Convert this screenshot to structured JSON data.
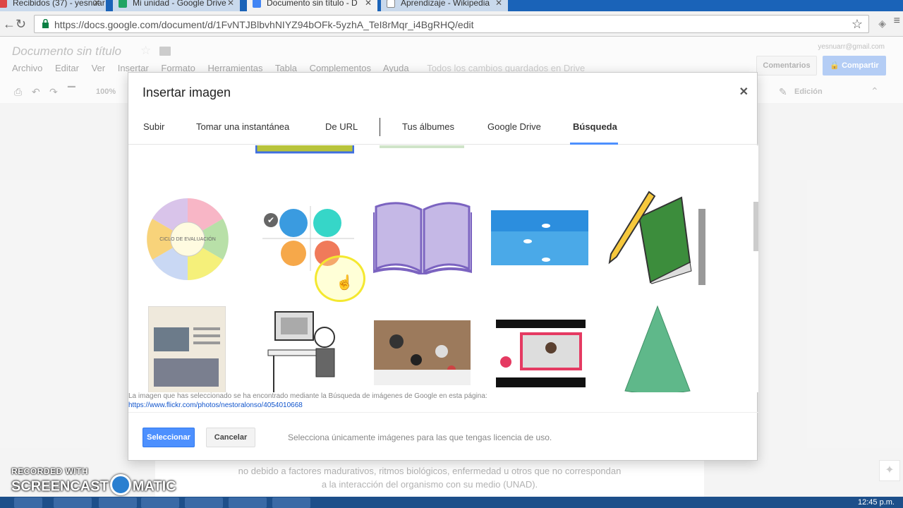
{
  "browser": {
    "tabs": [
      {
        "title": "Recibidos (37) - yesnuar",
        "active": false
      },
      {
        "title": "Mi unidad - Google Drive",
        "active": false
      },
      {
        "title": "Documento sin título - D",
        "active": true
      },
      {
        "title": "Aprendizaje - Wikipedia",
        "active": false
      }
    ],
    "url": "https://docs.google.com/document/d/1FvNTJBlbvhNIYZ94bOFk-5yzhA_TeI8rMqr_i4BgRHQ/edit"
  },
  "docs": {
    "title": "Documento sin título",
    "menu": [
      "Archivo",
      "Editar",
      "Ver",
      "Insertar",
      "Formato",
      "Herramientas",
      "Tabla",
      "Complementos",
      "Ayuda"
    ],
    "saved_status": "Todos los cambios guardados en Drive",
    "user_email": "yesnuarr@gmail.com",
    "comments_label": "Comentarios",
    "share_label": "Compartir",
    "zoom": "100%",
    "mode": "Edición",
    "body_text_line1": "no debido a factores madurativos, ritmos biológicos, enfermedad u otros que no correspondan",
    "body_text_line2": "a la interacción del organismo con su medio (UNAD)."
  },
  "dialog": {
    "title": "Insertar imagen",
    "tabs": [
      "Subir",
      "Tomar una instantánea",
      "De URL",
      "Tus álbumes",
      "Google Drive",
      "Búsqueda"
    ],
    "active_tab": "Búsqueda",
    "source_note": "La imagen que has seleccionado se ha encontrado mediante la Búsqueda de imágenes de Google en esta página:",
    "source_link": "https://www.flickr.com/photos/nestoralonso/4054010668",
    "select_label": "Seleccionar",
    "cancel_label": "Cancelar",
    "license_note": "Selecciona únicamente imágenes para las que tengas licencia de uso.",
    "wheel_label": "CICLO DE EVALUACIÓN"
  },
  "watermark": {
    "line1": "RECORDED WITH",
    "line2a": "SCREENCAST",
    "line2b": "MATIC"
  },
  "taskbar": {
    "clock": "12:45 p.m."
  },
  "colors": {
    "accent": "#4d90fe",
    "link": "#1155cc"
  }
}
